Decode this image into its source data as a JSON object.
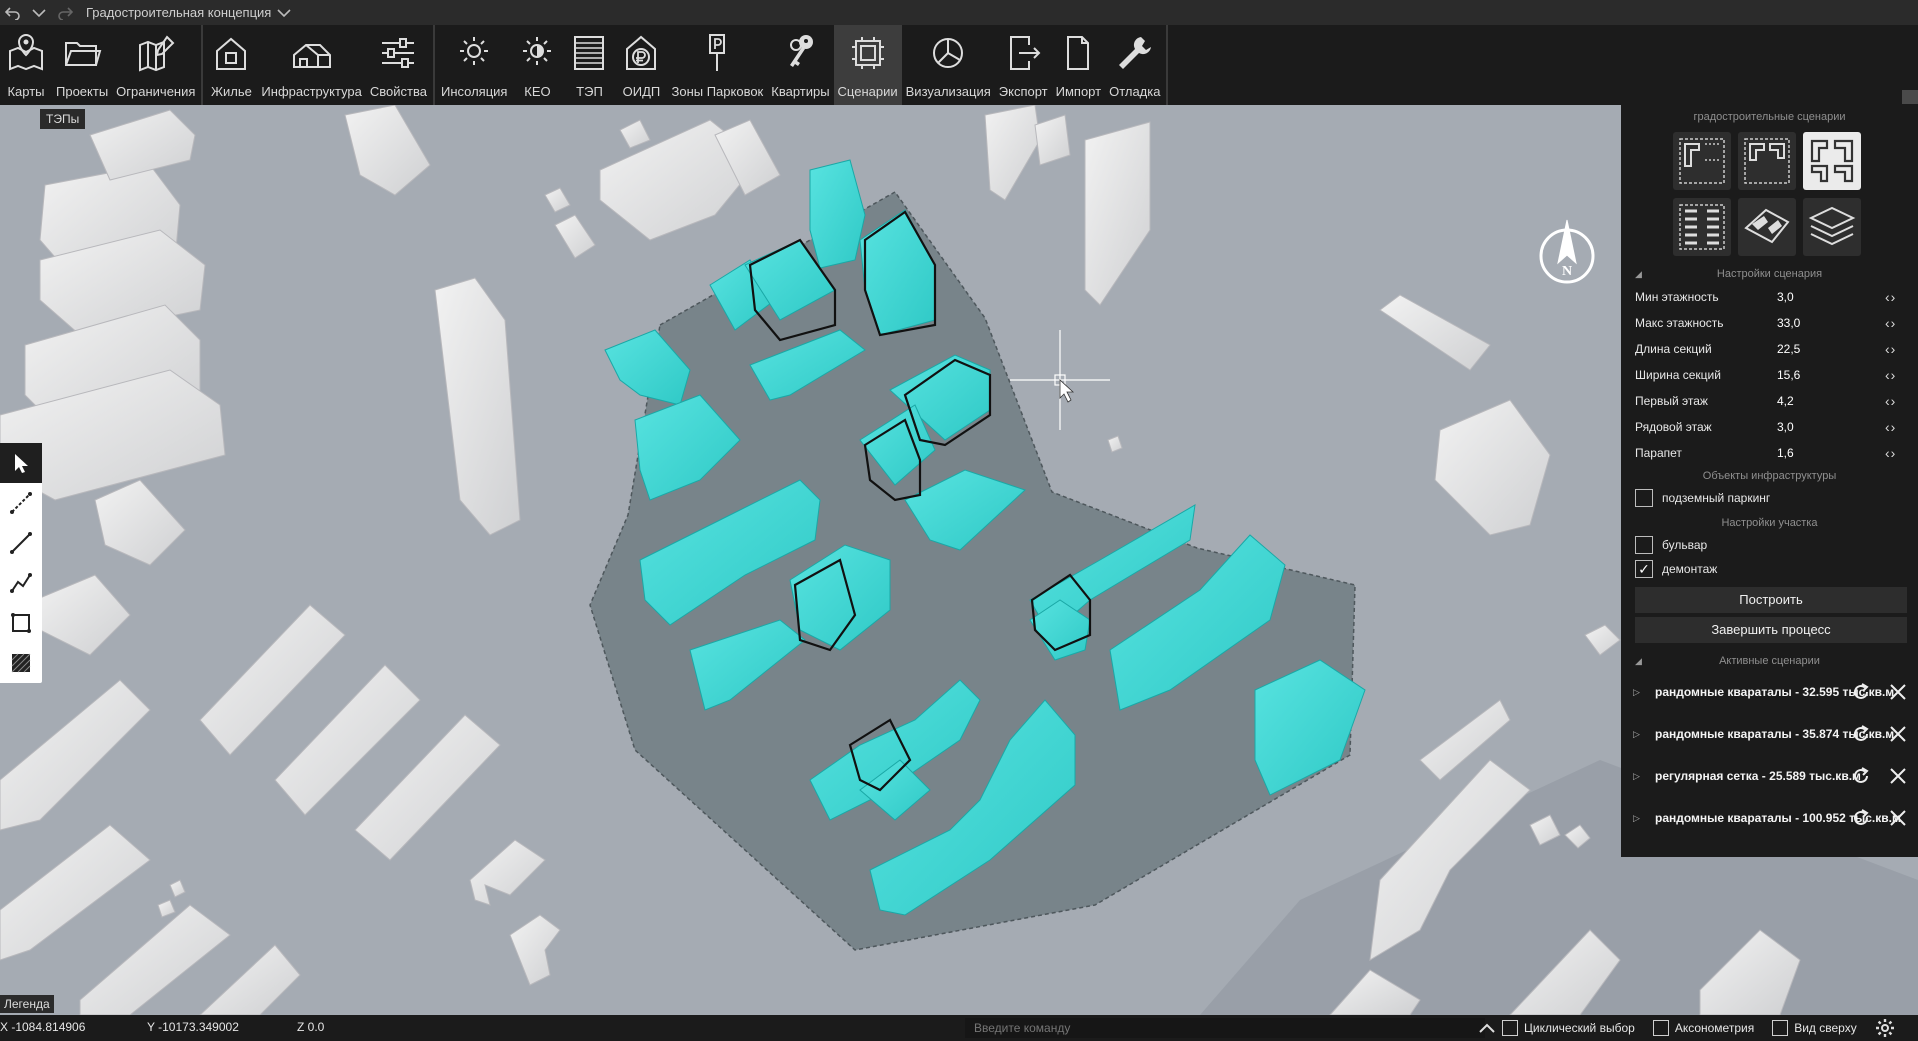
{
  "window": {
    "title": "Градостроительная концепция",
    "icons": [
      "undo-icon",
      "chevron-down-icon",
      "redo-icon",
      "chevron-down-icon"
    ]
  },
  "toolbar": {
    "items": [
      {
        "label": "Карты",
        "icon": "map-pin-icon"
      },
      {
        "label": "Проекты",
        "icon": "folder-icon"
      },
      {
        "label": "Ограничения",
        "icon": "map-edit-icon"
      },
      {
        "label": "Жилье",
        "icon": "house-icon"
      },
      {
        "label": "Инфраструктура",
        "icon": "building-icon"
      },
      {
        "label": "Свойства",
        "icon": "sliders-icon"
      },
      {
        "label": "Инсоляция",
        "icon": "sun-icon"
      },
      {
        "label": "КЕО",
        "icon": "daylight-icon"
      },
      {
        "label": "ТЭП",
        "icon": "table-icon"
      },
      {
        "label": "ОИДП",
        "icon": "ruble-house-icon"
      },
      {
        "label": "Зоны Парковок",
        "icon": "parking-sign-icon"
      },
      {
        "label": "Квартиры",
        "icon": "keys-icon"
      },
      {
        "label": "Сценарии",
        "icon": "scenario-icon",
        "active": true
      },
      {
        "label": "Визуализация",
        "icon": "pie-chart-icon"
      },
      {
        "label": "Экспорт",
        "icon": "export-icon"
      },
      {
        "label": "Импорт",
        "icon": "import-icon"
      },
      {
        "label": "Отладка",
        "icon": "wrench-icon"
      }
    ]
  },
  "viewport": {
    "teps_tag": "ТЭПы",
    "compass_label": "N",
    "legend": "Легенда"
  },
  "left_tools": [
    "select-arrow-icon",
    "dashed-line-icon",
    "line-icon",
    "polyline-icon",
    "rectangle-icon",
    "hatch-icon"
  ],
  "panel": {
    "scenarios_header": "градостроительные сценарии",
    "scenario_icons": [
      {
        "name": "scenario-grid-1-icon",
        "active": false
      },
      {
        "name": "scenario-grid-2-icon",
        "active": false
      },
      {
        "name": "scenario-grid-3-icon",
        "active": true
      },
      {
        "name": "scenario-rows-icon",
        "active": false
      },
      {
        "name": "scenario-diagonal-icon",
        "active": false
      },
      {
        "name": "scenario-layers-icon",
        "active": false
      }
    ],
    "settings_header": "Настройки сценария",
    "params": [
      {
        "label": "Мин этажность",
        "value": "3,0"
      },
      {
        "label": "Макс этажность",
        "value": "33,0"
      },
      {
        "label": "Длина секций",
        "value": "22,5"
      },
      {
        "label": "Ширина секций",
        "value": "15,6"
      },
      {
        "label": "Первый этаж",
        "value": "4,2"
      },
      {
        "label": "Рядовой этаж",
        "value": "3,0"
      },
      {
        "label": "Парапет",
        "value": "1,6"
      }
    ],
    "infra_header": "Объекты инфраструктуры",
    "underground_parking": {
      "label": "подземный паркинг",
      "checked": false
    },
    "site_header": "Настройки участка",
    "boulevard": {
      "label": "бульвар",
      "checked": false
    },
    "demolition": {
      "label": "демонтаж",
      "checked": true
    },
    "build_button": "Построить",
    "finish_button": "Завершить процесс",
    "active_header": "Активные сценарии",
    "active": [
      {
        "label": "рандомные квараталы -   32.595 тыс.кв.м"
      },
      {
        "label": "рандомные квараталы -   35.874 тыс.кв.м"
      },
      {
        "label": "регулярная сетка -   25.589 тыс.кв.м"
      },
      {
        "label": "рандомные квараталы -   100.952 тыс.кв.м"
      }
    ]
  },
  "status": {
    "x": "X -1084.814906",
    "y": "Y -10173.349002",
    "z": "Z 0.0",
    "command_placeholder": "Введите команду",
    "cyclic": "Циклический выбор",
    "axon": "Аксонометрия",
    "top": "Вид сверху"
  },
  "colors": {
    "toolbar_bg": "#1b1b1b",
    "active_tool_bg": "#3d3d3d",
    "ground": "#a5abb3",
    "site_polygon": "#6e7b81",
    "proposed_building": "#3fd6d3",
    "existing_building": "#e9e9e9"
  }
}
